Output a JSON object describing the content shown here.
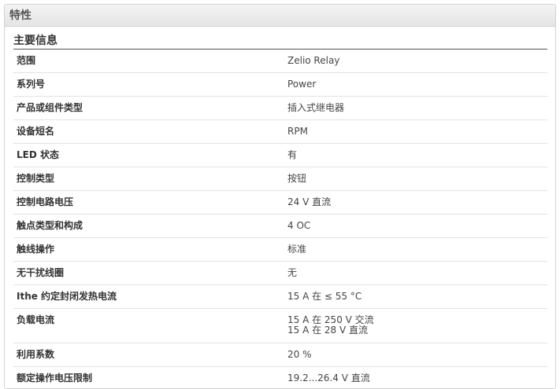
{
  "panel": {
    "title": "特性",
    "section_title": "主要信息"
  },
  "rows": [
    {
      "key": "范围",
      "values": [
        "Zelio Relay"
      ]
    },
    {
      "key": "系列号",
      "values": [
        "Power"
      ]
    },
    {
      "key": "产品或组件类型",
      "values": [
        "插入式继电器"
      ]
    },
    {
      "key": "设备短名",
      "values": [
        "RPM"
      ]
    },
    {
      "key": "LED 状态",
      "values": [
        "有"
      ]
    },
    {
      "key": "控制类型",
      "values": [
        "按钮"
      ]
    },
    {
      "key": "控制电路电压",
      "values": [
        "24 V 直流"
      ]
    },
    {
      "key": "触点类型和构成",
      "values": [
        "4 OC"
      ]
    },
    {
      "key": "触线操作",
      "values": [
        "标准"
      ]
    },
    {
      "key": "无干扰线圈",
      "values": [
        "无"
      ]
    },
    {
      "key": "Ithe 约定封闭发热电流",
      "values": [
        "15 A 在 ≤ 55 °C"
      ]
    },
    {
      "key": "负载电流",
      "values": [
        "15 A 在 250 V 交流",
        "15 A 在 28 V 直流"
      ]
    },
    {
      "key": "利用系数",
      "values": [
        "20 %"
      ]
    },
    {
      "key": "额定操作电压限制",
      "values": [
        "19.2...26.4 V 直流"
      ]
    }
  ]
}
